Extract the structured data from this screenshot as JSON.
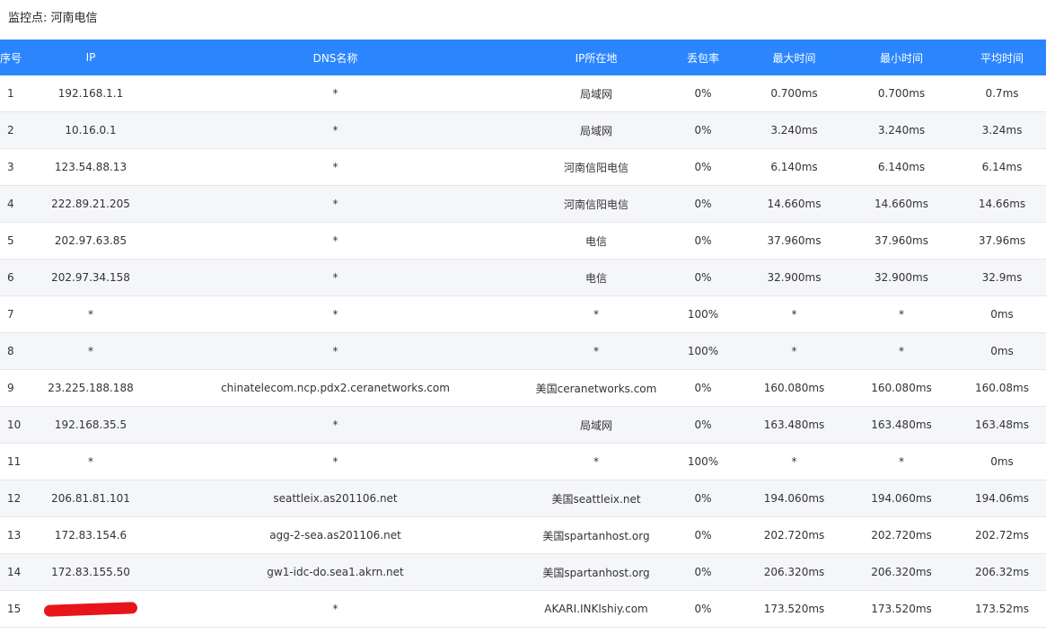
{
  "monitor": {
    "label": "监控点: 河南电信"
  },
  "columns": [
    "序号",
    "IP",
    "DNS名称",
    "IP所在地",
    "丢包率",
    "最大时间",
    "最小时间",
    "平均时间"
  ],
  "rows": [
    [
      "1",
      "192.168.1.1",
      "*",
      "局域网",
      "0%",
      "0.700ms",
      "0.700ms",
      "0.7ms"
    ],
    [
      "2",
      "10.16.0.1",
      "*",
      "局域网",
      "0%",
      "3.240ms",
      "3.240ms",
      "3.24ms"
    ],
    [
      "3",
      "123.54.88.13",
      "*",
      "河南信阳电信",
      "0%",
      "6.140ms",
      "6.140ms",
      "6.14ms"
    ],
    [
      "4",
      "222.89.21.205",
      "*",
      "河南信阳电信",
      "0%",
      "14.660ms",
      "14.660ms",
      "14.66ms"
    ],
    [
      "5",
      "202.97.63.85",
      "*",
      "电信",
      "0%",
      "37.960ms",
      "37.960ms",
      "37.96ms"
    ],
    [
      "6",
      "202.97.34.158",
      "*",
      "电信",
      "0%",
      "32.900ms",
      "32.900ms",
      "32.9ms"
    ],
    [
      "7",
      "*",
      "*",
      "*",
      "100%",
      "*",
      "*",
      "0ms"
    ],
    [
      "8",
      "*",
      "*",
      "*",
      "100%",
      "*",
      "*",
      "0ms"
    ],
    [
      "9",
      "23.225.188.188",
      "chinatelecom.ncp.pdx2.ceranetworks.com",
      "美国ceranetworks.com",
      "0%",
      "160.080ms",
      "160.080ms",
      "160.08ms"
    ],
    [
      "10",
      "192.168.35.5",
      "*",
      "局域网",
      "0%",
      "163.480ms",
      "163.480ms",
      "163.48ms"
    ],
    [
      "11",
      "*",
      "*",
      "*",
      "100%",
      "*",
      "*",
      "0ms"
    ],
    [
      "12",
      "206.81.81.101",
      "seattleix.as201106.net",
      "美国seattleix.net",
      "0%",
      "194.060ms",
      "194.060ms",
      "194.06ms"
    ],
    [
      "13",
      "172.83.154.6",
      "agg-2-sea.as201106.net",
      "美国spartanhost.org",
      "0%",
      "202.720ms",
      "202.720ms",
      "202.72ms"
    ],
    [
      "14",
      "172.83.155.50",
      "gw1-idc-do.sea1.akrn.net",
      "美国spartanhost.org",
      "0%",
      "206.320ms",
      "206.320ms",
      "206.32ms"
    ],
    [
      "15",
      "",
      "*",
      "AKARI.INKlshiy.com",
      "0%",
      "173.520ms",
      "173.520ms",
      "173.52ms"
    ]
  ]
}
